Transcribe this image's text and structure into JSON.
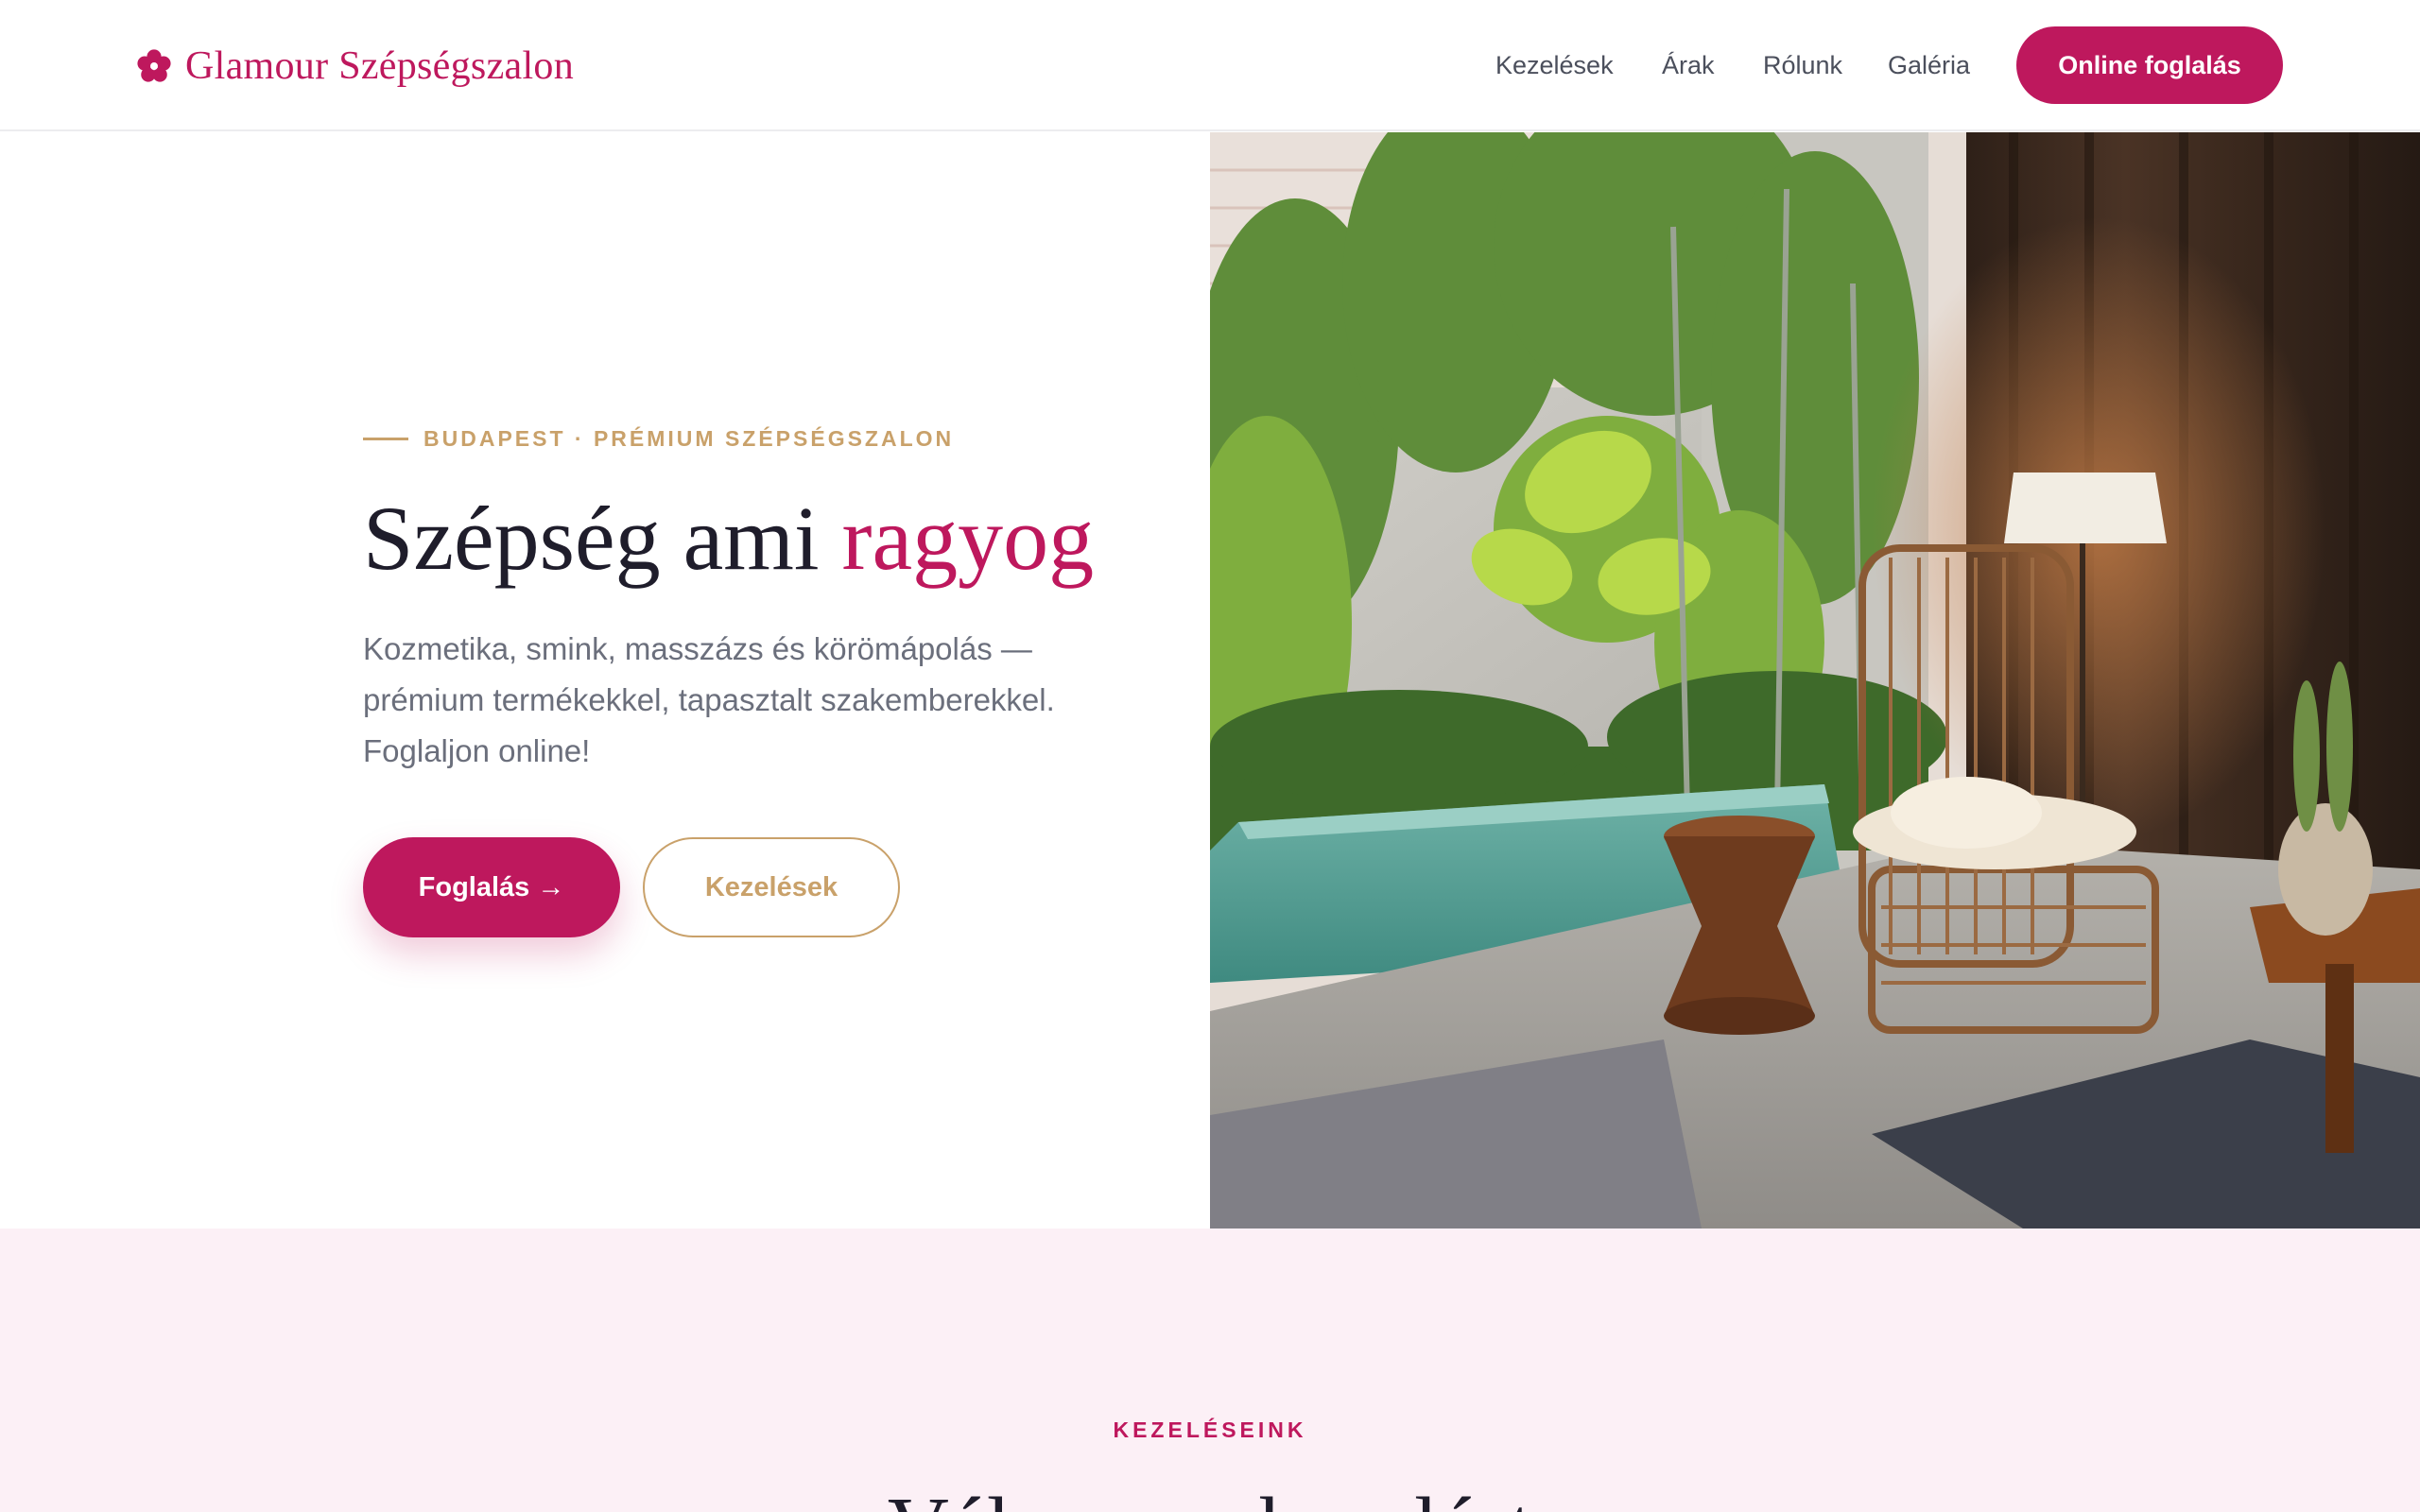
{
  "header": {
    "brand": "Glamour Szépségszalon",
    "nav": [
      "Kezelések",
      "Árak",
      "Rólunk",
      "Galéria"
    ],
    "cta": "Online foglalás"
  },
  "hero": {
    "eyebrow": "BUDAPEST · PRÉMIUM SZÉPSÉGSZALON",
    "title_main": "Szépség ami ",
    "title_accent": "ragyog",
    "subtitle": "Kozmetika, smink, masszázs és körömápolás — prémium termékekkel, tapasztalt szakemberekkel. Foglaljon online!",
    "primary_button": "Foglalás →",
    "secondary_button": "Kezelések"
  },
  "services": {
    "eyebrow": "KEZELÉSEINK",
    "title": "Válasszon kezelést"
  },
  "colors": {
    "brand": "#be185d",
    "gold": "#c9a16a",
    "section_bg": "#fcf0f6"
  },
  "icons": {
    "logo": "flower-icon"
  }
}
